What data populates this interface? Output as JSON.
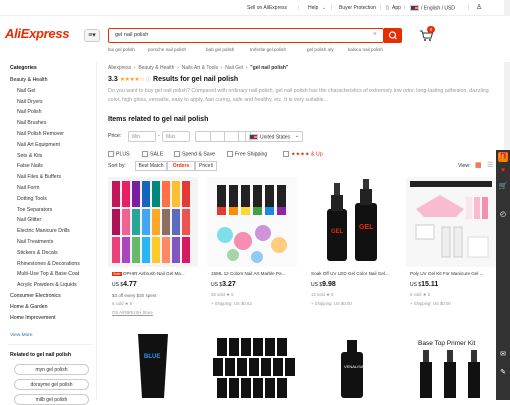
{
  "topbar": {
    "sell": "Sell on AliExpress",
    "help": "Help",
    "buyer_protection": "Buyer Protection",
    "app": "App",
    "locale": "/ English / USD"
  },
  "header": {
    "logo": "AliExpress",
    "search_value": "gel nail polish",
    "cart_count": "0",
    "suggestions": [
      "bui gel polish",
      "porsche nail polish",
      "bab gel polish",
      "trvferite gel polish",
      "gel polish oly",
      "kalocu nail polish"
    ]
  },
  "sidebar": {
    "categories_title": "Categories",
    "items": [
      {
        "label": "Beauty & Health",
        "level": 0,
        "bold": false
      },
      {
        "label": "Nail Gel",
        "level": 1,
        "bold": false
      },
      {
        "label": "Nail Dryers",
        "level": 1,
        "bold": false
      },
      {
        "label": "Nail Polish",
        "level": 1,
        "bold": false
      },
      {
        "label": "Nail Brushes",
        "level": 1,
        "bold": false
      },
      {
        "label": "Nail Polish Remover",
        "level": 1,
        "bold": false
      },
      {
        "label": "Nail Art Equipment",
        "level": 1,
        "bold": false
      },
      {
        "label": "Sets & Kits",
        "level": 1,
        "bold": false
      },
      {
        "label": "False Nails",
        "level": 1,
        "bold": false
      },
      {
        "label": "Nail Files & Buffers",
        "level": 1,
        "bold": false
      },
      {
        "label": "Nail Form",
        "level": 1,
        "bold": false
      },
      {
        "label": "Dotting Tools",
        "level": 1,
        "bold": false
      },
      {
        "label": "Toe Separators",
        "level": 1,
        "bold": false
      },
      {
        "label": "Nail Glitter",
        "level": 1,
        "bold": false
      },
      {
        "label": "Electric Manicure Drills",
        "level": 1,
        "bold": false
      },
      {
        "label": "Nail Treatments",
        "level": 1,
        "bold": false
      },
      {
        "label": "Stickers & Decals",
        "level": 1,
        "bold": false
      },
      {
        "label": "Rhinestones & Decorations",
        "level": 1,
        "bold": false
      },
      {
        "label": "Multi-Use Top & Base Coat",
        "level": 1,
        "bold": false
      },
      {
        "label": "Acrylic Powders & Liquids",
        "level": 1,
        "bold": false
      },
      {
        "label": "Consumer Electronics",
        "level": 0,
        "bold": false
      },
      {
        "label": "Home & Garden",
        "level": 0,
        "bold": false
      },
      {
        "label": "Home Improvement",
        "level": 0,
        "bold": false
      }
    ],
    "view_more": "View More",
    "related_title": "Related to gel nail polish",
    "related": [
      "myn gel polish",
      "dorayme gel polish",
      "milb gel polish"
    ]
  },
  "main": {
    "breadcrumb": [
      "Aliexpress",
      "Beauty & Health",
      "Nails Art & Tools",
      "Nail Gel"
    ],
    "breadcrumb_query": "\"gel nail polish\"",
    "rating_value": "3.3",
    "rating_stars": "★★★★☆",
    "results_text": "Results for gel nail polish",
    "description": "Do you want to buy gel nail polish? Compared with ordinary nail polish, gel nail polish has the characteristics of extremely low odor, long-lasting adhesion, dazzling color, high gloss, versatile, easy to apply, fast curing, safe and healthy, etc. It is very suitable...",
    "items_related": "Items related to gel nail polish",
    "price_label": "Price:",
    "min_placeholder": "Min.",
    "max_placeholder": "Max",
    "ship_country": "United States",
    "filters": [
      "PLUS",
      "SALE",
      "Spend & Save",
      "Free Shipping"
    ],
    "rating_filter": "★★★★ & Up",
    "sort_label": "Sort by:",
    "sort_options": [
      "Best Match",
      "Orders",
      "Price"
    ],
    "view_label": "View:"
  },
  "products": [
    {
      "title": "OPHIR Airbrush Nail Gel Ma...",
      "price_prefix": "US $",
      "price": "4.77",
      "line3": "$3 off every $30 spent",
      "line4": "6 sold  ★ 5",
      "line5": "OS AIRBRUSH Store",
      "choice": true
    },
    {
      "title": "15ML 12 Colors Nail Art Marble Pa...",
      "price_prefix": "US $",
      "price": "3.27",
      "line3": "",
      "line4": "28 sold  ★ 5",
      "line5": "+ Shipping: US $0.62",
      "choice": false
    },
    {
      "title": "Soak Off UV LED Gel Color Nail Gel...",
      "price_prefix": "US $",
      "price": "9.98",
      "line3": "",
      "line4": "13 sold  ★ 5",
      "line5": "+ Shipping: US $0.00",
      "choice": false
    },
    {
      "title": "Poly UV Gel Kit For Manicure Gel ...",
      "price_prefix": "US $",
      "price": "15.11",
      "line3": "",
      "line4": "5 sold  ★ 5",
      "line5": "+ Shipping: US $0.00",
      "choice": false
    },
    {
      "title": "Base Top Primer Kit",
      "price_prefix": "",
      "price": "",
      "line3": "",
      "line4": "",
      "line5": "",
      "choice": false
    }
  ],
  "colors": {
    "brand": "#e62e04",
    "star": "#f5a623"
  }
}
